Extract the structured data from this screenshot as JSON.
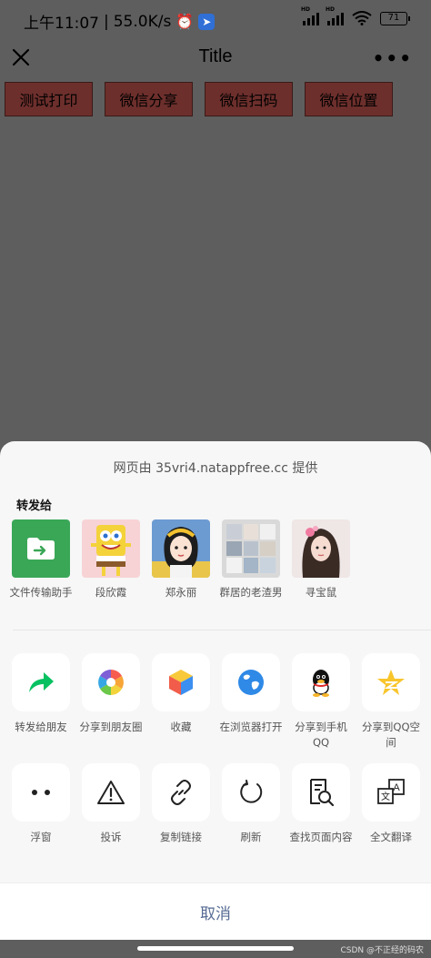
{
  "status_bar": {
    "time": "上午11:07",
    "separator": "|",
    "speed": "55.0K/s",
    "battery": "71",
    "signal_label": "HD"
  },
  "navbar": {
    "title": "Title",
    "close_icon": "close-icon",
    "more_label": "•••"
  },
  "page_buttons": [
    {
      "label": "测试打印"
    },
    {
      "label": "微信分享"
    },
    {
      "label": "微信扫码"
    },
    {
      "label": "微信位置"
    }
  ],
  "sheet": {
    "provider": "网页由 35vri4.natappfree.cc 提供",
    "forward_title": "转发给",
    "contacts": [
      {
        "name": "文件传输助手",
        "icon": "folder-arrow-icon"
      },
      {
        "name": "段欣霞",
        "icon": "avatar-cartoon"
      },
      {
        "name": "郑永丽",
        "icon": "avatar-girl-illustration"
      },
      {
        "name": "群居的老渣男",
        "icon": "avatar-group-grid"
      },
      {
        "name": "寻宝鼠",
        "icon": "avatar-photo"
      }
    ],
    "actions_row1": [
      {
        "label": "转发给朋友",
        "icon": "forward-arrow-icon"
      },
      {
        "label": "分享到朋友圈",
        "icon": "moments-aperture-icon"
      },
      {
        "label": "收藏",
        "icon": "favorites-cube-icon"
      },
      {
        "label": "在浏览器打开",
        "icon": "browser-globe-icon"
      },
      {
        "label": "分享到手机QQ",
        "icon": "qq-penguin-icon"
      },
      {
        "label": "分享到QQ空间",
        "icon": "qzone-star-icon"
      }
    ],
    "actions_row2": [
      {
        "label": "浮窗",
        "icon": "float-window-icon"
      },
      {
        "label": "投诉",
        "icon": "warning-triangle-icon"
      },
      {
        "label": "复制链接",
        "icon": "link-icon"
      },
      {
        "label": "刷新",
        "icon": "refresh-icon"
      },
      {
        "label": "查找页面内容",
        "icon": "search-document-icon"
      },
      {
        "label": "全文翻译",
        "icon": "translate-icon"
      }
    ],
    "cancel": "取消"
  },
  "watermark": "CSDN @不正经的码农",
  "colors": {
    "overlay": "#5e5e5e",
    "page_button": "#6d2f2c",
    "sheet_bg": "#f7f7f7",
    "cancel_text": "#566b94",
    "file_transfer_green": "#3aa757"
  }
}
